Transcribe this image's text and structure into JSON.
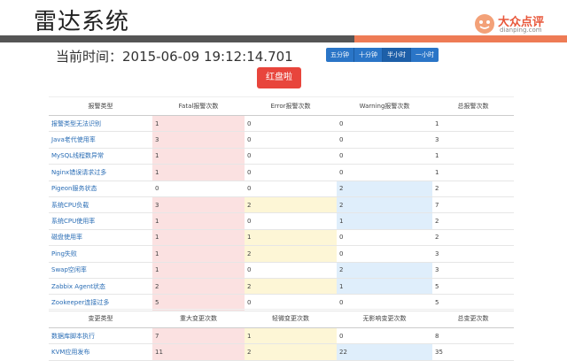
{
  "slide": {
    "title": "雷达系统"
  },
  "logo": {
    "cn": "大众点评",
    "url": "dianping.com"
  },
  "header": {
    "time_label": "当前时间：2015-06-09 19:12:14.701"
  },
  "range_buttons": [
    "五分钟",
    "十分钟",
    "半小时",
    "一小时"
  ],
  "red_button": "红盘啦",
  "alarm_table": {
    "headers": [
      "报警类型",
      "Fatal报警次数",
      "Error报警次数",
      "Warning报警次数",
      "总报警次数"
    ],
    "rows": [
      {
        "name": "报警类型无法识别",
        "fatal": "1",
        "error": "0",
        "warning": "0",
        "total": "1"
      },
      {
        "name": "Java老代使用率",
        "fatal": "3",
        "error": "0",
        "warning": "0",
        "total": "3"
      },
      {
        "name": "MySQL线程数异常",
        "fatal": "1",
        "error": "0",
        "warning": "0",
        "total": "1"
      },
      {
        "name": "Nginx错误请求过多",
        "fatal": "1",
        "error": "0",
        "warning": "0",
        "total": "1"
      },
      {
        "name": "Pigeon服务状态",
        "fatal": "0",
        "error": "0",
        "warning": "2",
        "total": "2"
      },
      {
        "name": "系统CPU负载",
        "fatal": "3",
        "error": "2",
        "warning": "2",
        "total": "7"
      },
      {
        "name": "系统CPU使用率",
        "fatal": "1",
        "error": "0",
        "warning": "1",
        "total": "2"
      },
      {
        "name": "磁盘使用率",
        "fatal": "1",
        "error": "1",
        "warning": "0",
        "total": "2"
      },
      {
        "name": "Ping失败",
        "fatal": "1",
        "error": "2",
        "warning": "0",
        "total": "3"
      },
      {
        "name": "Swap空闲率",
        "fatal": "1",
        "error": "0",
        "warning": "2",
        "total": "3"
      },
      {
        "name": "Zabbix Agent状态",
        "fatal": "2",
        "error": "2",
        "warning": "1",
        "total": "5"
      },
      {
        "name": "Zookeeper连接过多",
        "fatal": "5",
        "error": "0",
        "warning": "0",
        "total": "5"
      }
    ]
  },
  "change_table": {
    "headers": [
      "变更类型",
      "重大变更次数",
      "轻微变更次数",
      "无影响变更次数",
      "总变更次数"
    ],
    "rows": [
      {
        "name": "数据库脚本执行",
        "major": "7",
        "minor": "1",
        "none": "0",
        "total": "8"
      },
      {
        "name": "KVM应用发布",
        "major": "11",
        "minor": "2",
        "none": "22",
        "total": "35"
      }
    ]
  },
  "colors": {
    "fatal_bg": "#fbe1e1",
    "error_bg": "#fdf6d6",
    "warning_bg": "#dfeefb",
    "red_button": "#e8453c",
    "range_button": "#2a75c7",
    "accent_bar": "#ee7b55"
  }
}
